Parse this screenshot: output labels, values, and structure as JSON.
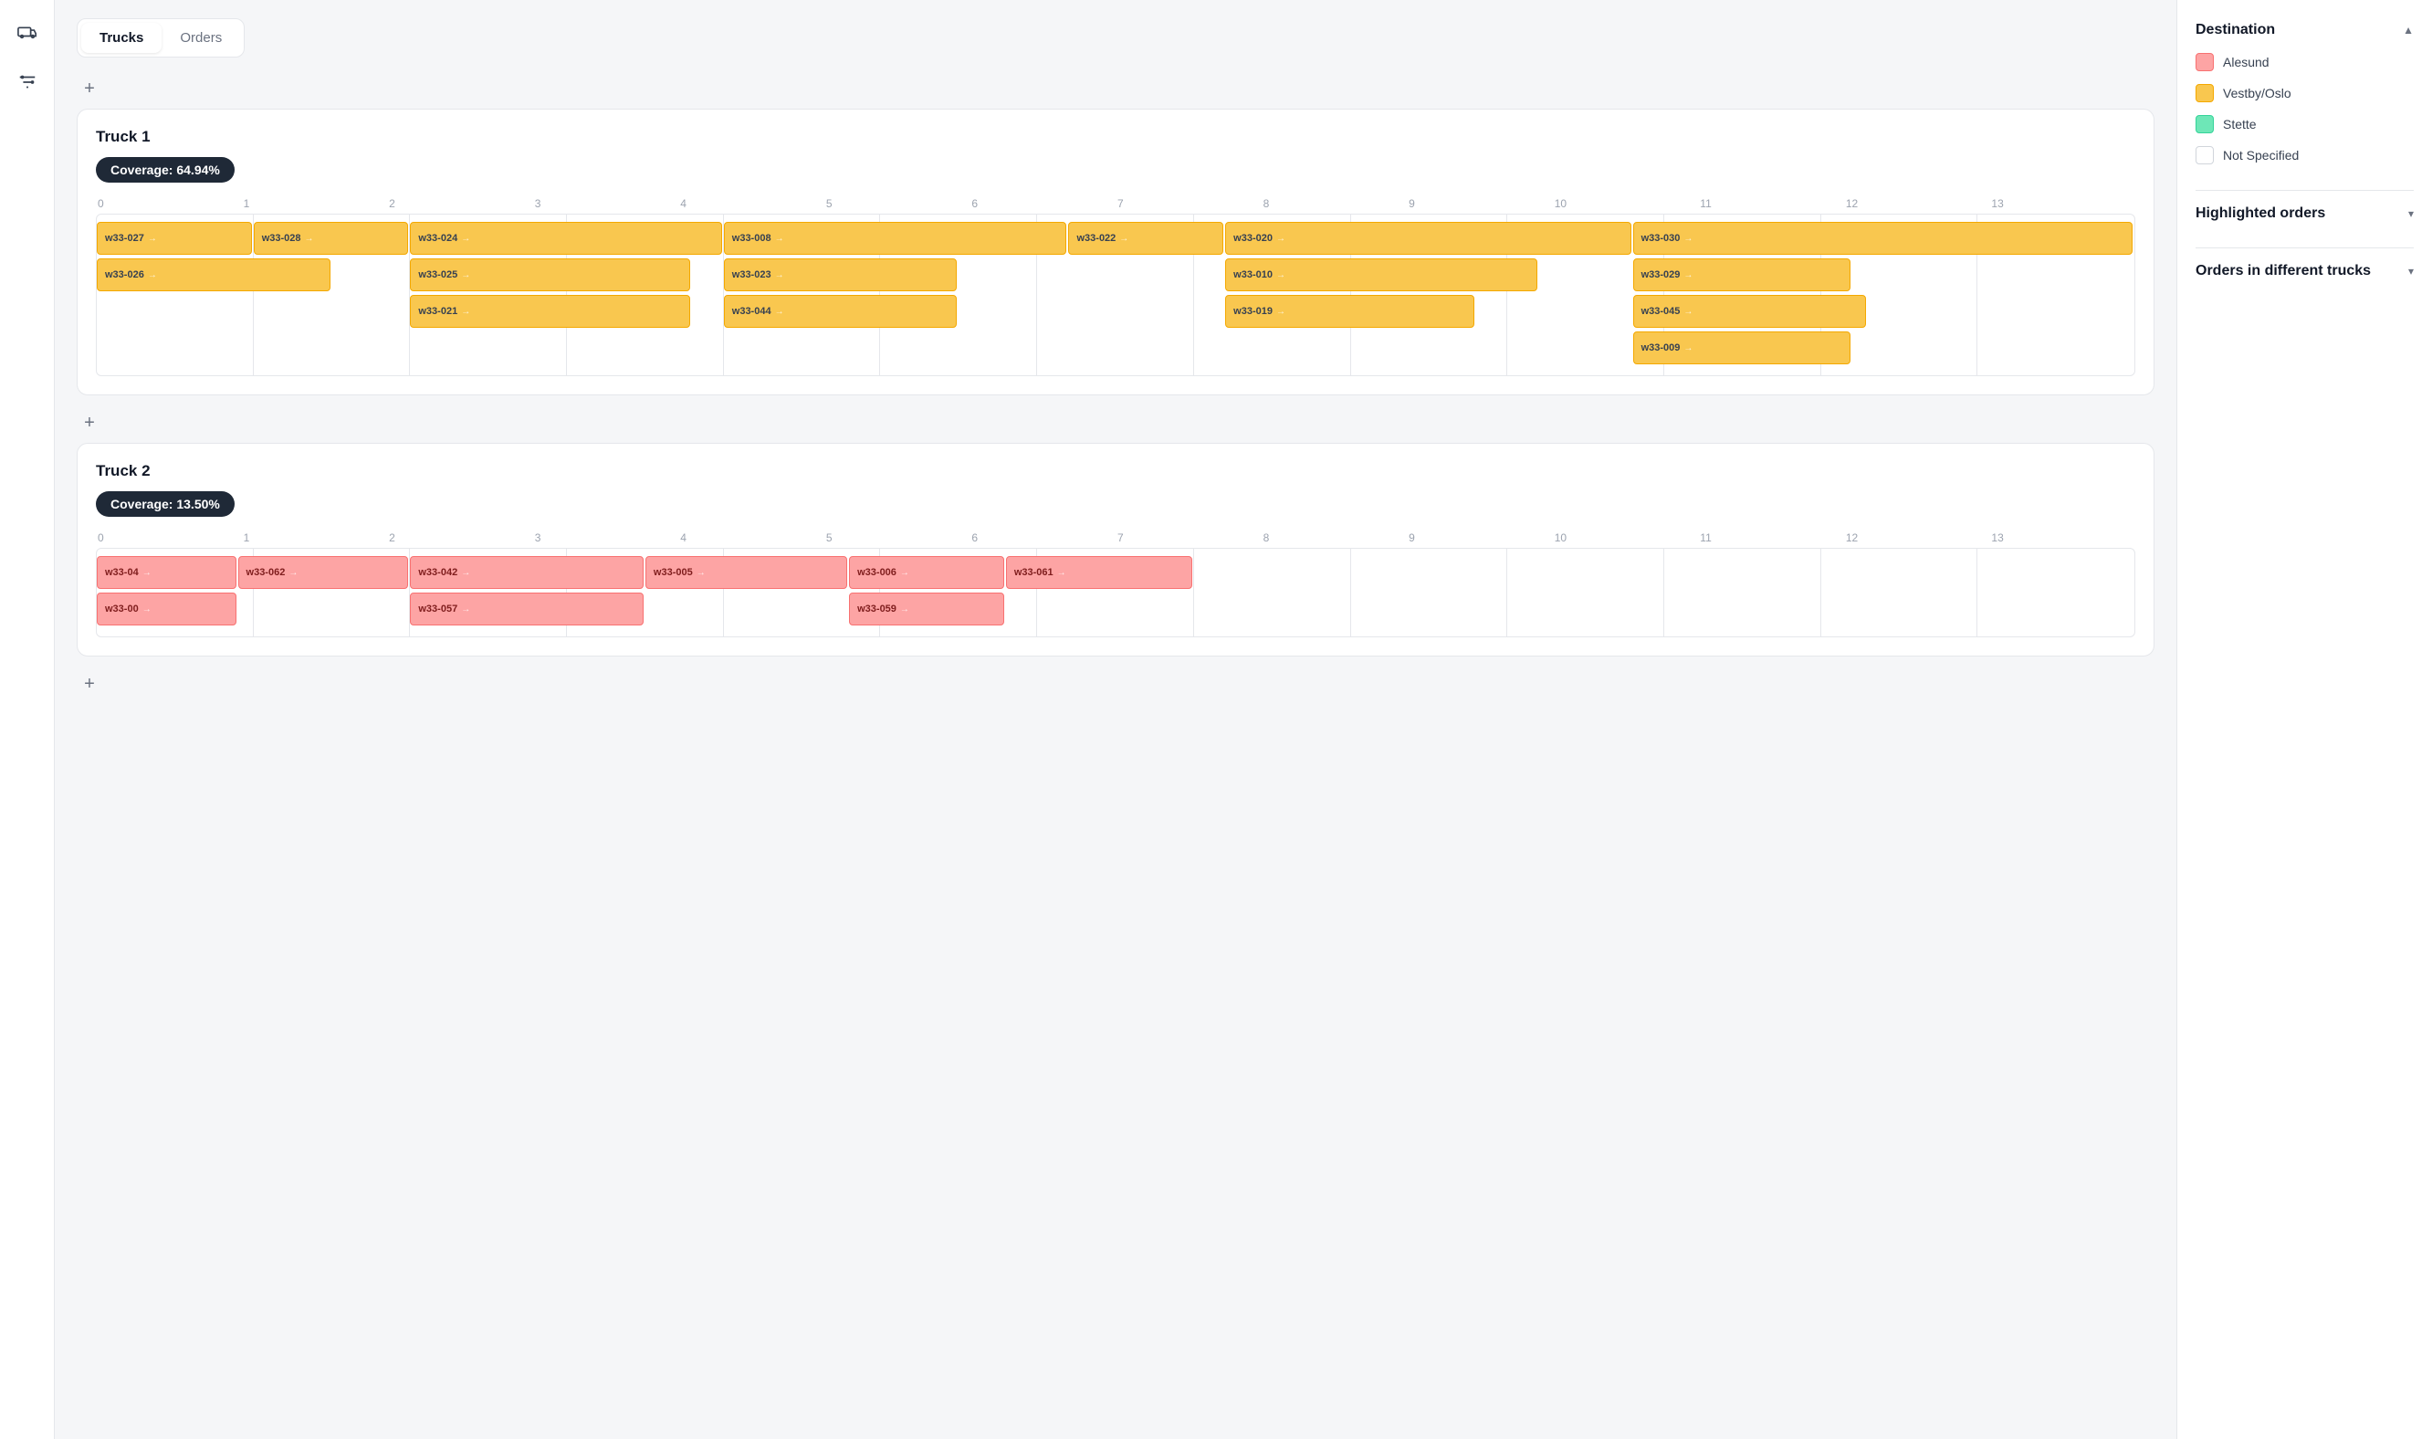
{
  "sidebar": {
    "icons": [
      {
        "name": "truck-icon",
        "label": "Trucks"
      },
      {
        "name": "filter-icon",
        "label": "Filters"
      }
    ]
  },
  "tabs": [
    {
      "id": "trucks",
      "label": "Trucks",
      "active": true
    },
    {
      "id": "orders",
      "label": "Orders",
      "active": false
    }
  ],
  "trucks": [
    {
      "id": "truck1",
      "title": "Truck 1",
      "coverage": "Coverage: 64.94%",
      "rows": [
        [
          {
            "id": "w33-027",
            "color": "yellow",
            "col_start": 0,
            "col_end": 1.0,
            "row": 0
          },
          {
            "id": "w33-028",
            "color": "yellow",
            "col_start": 1.0,
            "col_end": 2.0,
            "row": 0
          },
          {
            "id": "w33-024",
            "color": "yellow",
            "col_start": 2.0,
            "col_end": 4.0,
            "row": 0
          },
          {
            "id": "w33-008",
            "color": "yellow",
            "col_start": 4.0,
            "col_end": 6.2,
            "row": 0
          },
          {
            "id": "w33-022",
            "color": "yellow",
            "col_start": 6.2,
            "col_end": 7.2,
            "row": 0
          },
          {
            "id": "w33-020",
            "color": "yellow",
            "col_start": 7.2,
            "col_end": 9.8,
            "row": 0
          },
          {
            "id": "w33-030",
            "color": "yellow",
            "col_start": 9.8,
            "col_end": 13.0,
            "row": 0
          }
        ],
        [
          {
            "id": "w33-026",
            "color": "yellow",
            "col_start": 0,
            "col_end": 1.5,
            "row": 1
          },
          {
            "id": "w33-025",
            "color": "yellow",
            "col_start": 2.0,
            "col_end": 3.8,
            "row": 1
          },
          {
            "id": "w33-023",
            "color": "yellow",
            "col_start": 4.0,
            "col_end": 5.5,
            "row": 1
          },
          {
            "id": "w33-010",
            "color": "yellow",
            "col_start": 7.2,
            "col_end": 9.2,
            "row": 1
          },
          {
            "id": "w33-029",
            "color": "yellow",
            "col_start": 9.8,
            "col_end": 11.2,
            "row": 1
          },
          {
            "id": "w33-045",
            "color": "yellow",
            "col_start": 9.8,
            "col_end": 11.3,
            "row": 2
          },
          {
            "id": "w33-009",
            "color": "yellow",
            "col_start": 9.8,
            "col_end": 11.2,
            "row": 3
          }
        ],
        [
          {
            "id": "w33-021",
            "color": "yellow",
            "col_start": 2.0,
            "col_end": 3.8,
            "row": 2
          },
          {
            "id": "w33-044",
            "color": "yellow",
            "col_start": 4.0,
            "col_end": 5.5,
            "row": 2
          },
          {
            "id": "w33-019",
            "color": "yellow",
            "col_start": 7.2,
            "col_end": 8.8,
            "row": 2
          }
        ]
      ]
    },
    {
      "id": "truck2",
      "title": "Truck 2",
      "coverage": "Coverage: 13.50%",
      "rows": [
        [
          {
            "id": "w33-04",
            "color": "pink",
            "col_start": 0,
            "col_end": 0.9,
            "row": 0
          },
          {
            "id": "w33-062",
            "color": "pink",
            "col_start": 0.9,
            "col_end": 2.0,
            "row": 0
          },
          {
            "id": "w33-042",
            "color": "pink",
            "col_start": 2.0,
            "col_end": 3.5,
            "row": 0
          },
          {
            "id": "w33-005",
            "color": "pink",
            "col_start": 3.5,
            "col_end": 4.8,
            "row": 0
          },
          {
            "id": "w33-006",
            "color": "pink",
            "col_start": 4.8,
            "col_end": 5.8,
            "row": 0
          },
          {
            "id": "w33-061",
            "color": "pink",
            "col_start": 5.8,
            "col_end": 7.0,
            "row": 0
          }
        ],
        [
          {
            "id": "w33-00",
            "color": "pink",
            "col_start": 0,
            "col_end": 0.9,
            "row": 1
          },
          {
            "id": "w33-057",
            "color": "pink",
            "col_start": 2.0,
            "col_end": 3.5,
            "row": 1
          },
          {
            "id": "w33-059",
            "color": "pink",
            "col_start": 4.8,
            "col_end": 5.8,
            "row": 1
          }
        ]
      ]
    }
  ],
  "timeline_labels": [
    "0",
    "1",
    "2",
    "3",
    "4",
    "5",
    "6",
    "7",
    "8",
    "9",
    "10",
    "11",
    "12",
    "13"
  ],
  "right_panel": {
    "destination_title": "Destination",
    "destination_expanded": true,
    "legend": [
      {
        "color": "pink",
        "label": "Alesund"
      },
      {
        "color": "yellow",
        "label": "Vestby/Oslo"
      },
      {
        "color": "green",
        "label": "Stette"
      },
      {
        "color": "white",
        "label": "Not Specified"
      }
    ],
    "highlighted_orders_title": "Highlighted orders",
    "highlighted_orders_expanded": true,
    "orders_different_trucks_title": "Orders in different trucks",
    "orders_different_trucks_expanded": true
  },
  "add_buttons": [
    {
      "label": "+"
    },
    {
      "label": "+"
    }
  ]
}
